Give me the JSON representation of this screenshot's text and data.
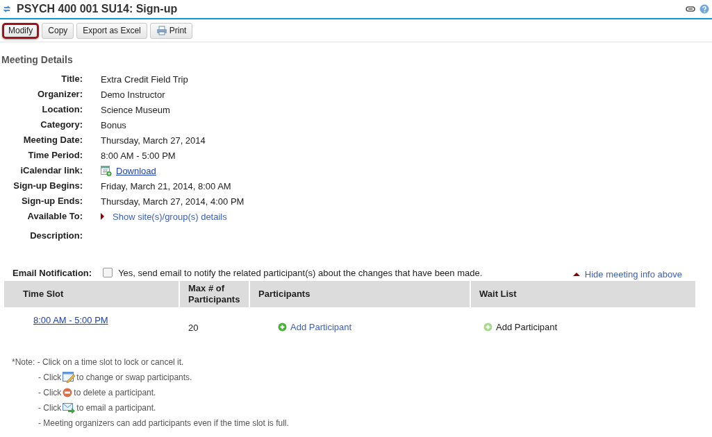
{
  "title": "PSYCH 400 001 SU14: Sign-up",
  "toolbar": [
    {
      "label": "Modify",
      "kind": "text",
      "highlighted": true
    },
    {
      "label": "Copy",
      "kind": "text",
      "highlighted": false
    },
    {
      "label": "Export as Excel",
      "kind": "text",
      "highlighted": false
    },
    {
      "label": "Print",
      "kind": "print",
      "highlighted": false
    }
  ],
  "section_title": "Meeting Details",
  "details": [
    {
      "label": "Title:",
      "value": "Extra Credit Field Trip",
      "kind": "text"
    },
    {
      "label": "Organizer:",
      "value": "Demo Instructor",
      "kind": "text"
    },
    {
      "label": "Location:",
      "value": "Science Museum",
      "kind": "text"
    },
    {
      "label": "Category:",
      "value": "Bonus",
      "kind": "text"
    },
    {
      "label": "Meeting Date:",
      "value": "Thursday, March 27, 2014",
      "kind": "text"
    },
    {
      "label": "Time Period:",
      "value": "8:00 AM  -  5:00 PM",
      "kind": "text"
    },
    {
      "label": "iCalendar link:",
      "value": "Download",
      "kind": "calendar_link"
    },
    {
      "label": "Sign-up Begins:",
      "value": "Friday, March 21, 2014, 8:00 AM",
      "kind": "text"
    },
    {
      "label": "Sign-up Ends:",
      "value": "Thursday, March 27, 2014, 4:00 PM",
      "kind": "text"
    },
    {
      "label": "Available To:",
      "value": "Show site(s)/group(s) details",
      "kind": "toggle"
    },
    {
      "label": "Description:",
      "kind": "empty"
    }
  ],
  "email_notification": {
    "label": "Email Notification:",
    "checkbox_label": "Yes, send email to notify the related participant(s) about the changes that have been made.",
    "checked": false
  },
  "hide_link": "Hide meeting info above",
  "table": {
    "columns": [
      "Time Slot",
      "Max # of Participants",
      "Participants",
      "Wait List"
    ],
    "rows": [
      {
        "time_slot": "8:00 AM  -  5:00 PM",
        "max": "20",
        "participants": "Add Participant",
        "wait_list": "Add Participant"
      }
    ]
  },
  "notes": [
    {
      "before": "*Note: - Click on a time slot to lock or cancel it.",
      "kind": "text"
    },
    {
      "before": "- Click",
      "after": "to change or swap participants.",
      "kind": "edit"
    },
    {
      "before": "- Click",
      "after": "to delete a participant.",
      "kind": "delete"
    },
    {
      "before": "- Click",
      "after": "to email a participant.",
      "kind": "email"
    },
    {
      "before": "- Meeting organizers can add participants even if the time slot is full.",
      "kind": "text"
    }
  ]
}
